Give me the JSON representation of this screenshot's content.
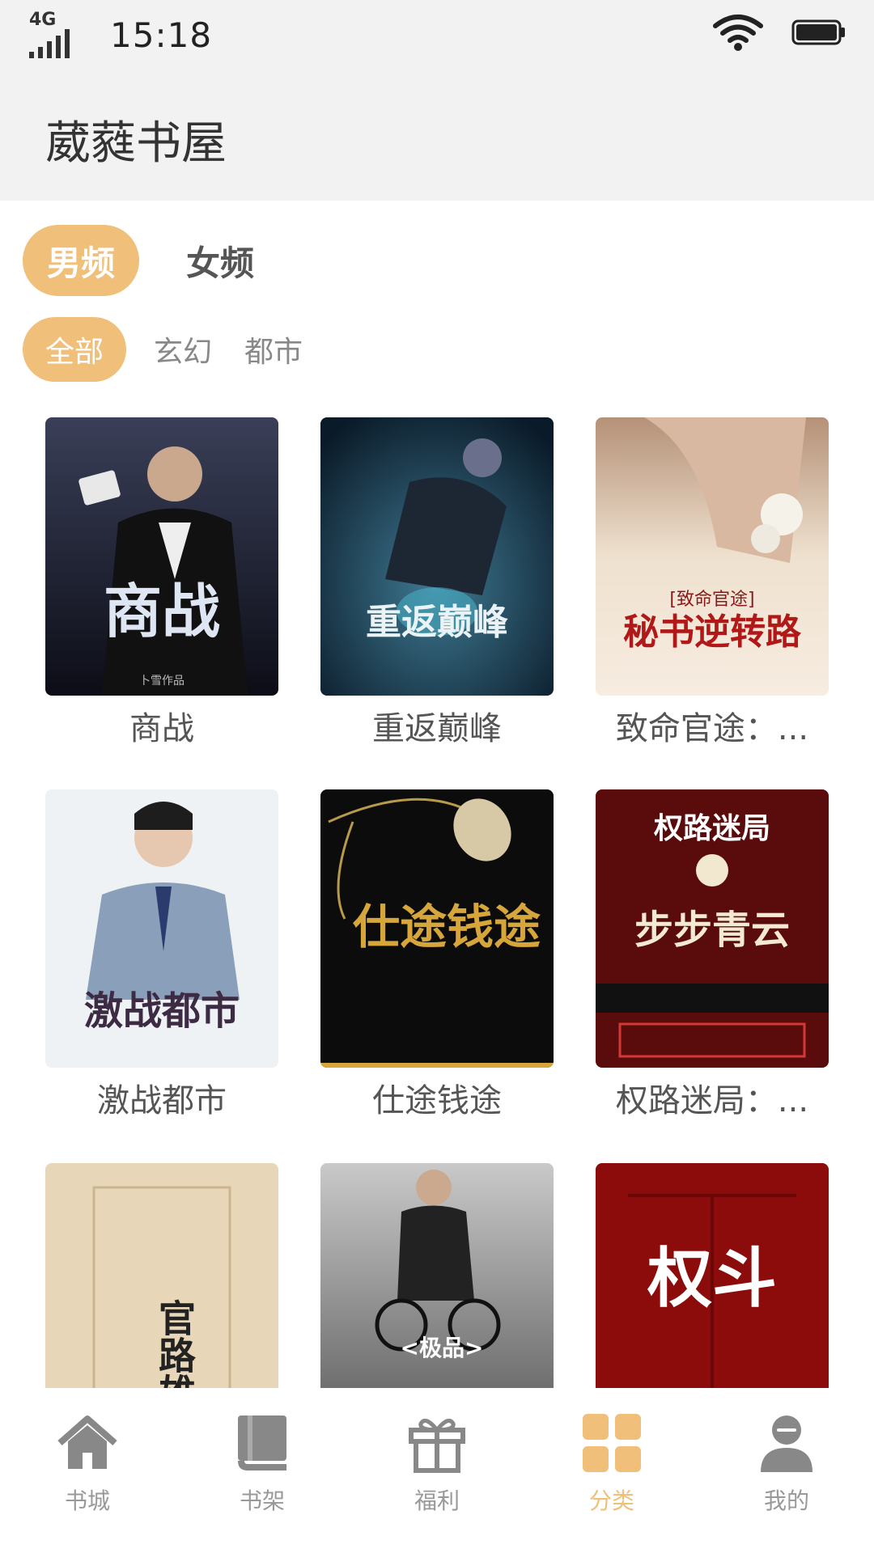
{
  "status_bar": {
    "network": "4G",
    "time": "15:18",
    "icons": [
      "signal-icon",
      "wifi-icon",
      "battery-icon"
    ]
  },
  "header": {
    "title": "葳蕤书屋"
  },
  "gender_tabs": [
    {
      "label": "男频",
      "active": true
    },
    {
      "label": "女频",
      "active": false
    }
  ],
  "category_tabs": [
    {
      "label": "全部",
      "active": true
    },
    {
      "label": "玄幻",
      "active": false
    },
    {
      "label": "都市",
      "active": false
    }
  ],
  "books": [
    {
      "title": "商战",
      "cover_text": "商战",
      "cover_sub": "卜雪作品"
    },
    {
      "title": "重返巅峰",
      "cover_text": "重返巅峰",
      "cover_sub": ""
    },
    {
      "title": "致命官途：...",
      "cover_text": "秘书逆转路",
      "cover_sub": "[致命官途]"
    },
    {
      "title": "激战都市",
      "cover_text": "激战都市",
      "cover_sub": ""
    },
    {
      "title": "仕途钱途",
      "cover_text": "仕途钱途",
      "cover_sub": ""
    },
    {
      "title": "权路迷局：...",
      "cover_text": "步步青云",
      "cover_sub": "权路迷局"
    },
    {
      "title": "",
      "cover_text": "官路雄才",
      "cover_sub": ""
    },
    {
      "title": "",
      "cover_text": "<极品>",
      "cover_sub": ""
    },
    {
      "title": "",
      "cover_text": "权斗",
      "cover_sub": ""
    }
  ],
  "bottom_nav": [
    {
      "label": "书城",
      "icon": "home-icon",
      "active": false
    },
    {
      "label": "书架",
      "icon": "bookshelf-icon",
      "active": false
    },
    {
      "label": "福利",
      "icon": "gift-icon",
      "active": false
    },
    {
      "label": "分类",
      "icon": "category-grid-icon",
      "active": true
    },
    {
      "label": "我的",
      "icon": "user-icon",
      "active": false
    }
  ],
  "colors": {
    "accent": "#f0bf7a",
    "header_bg": "#f2f2f2",
    "nav_inactive": "#999999"
  }
}
